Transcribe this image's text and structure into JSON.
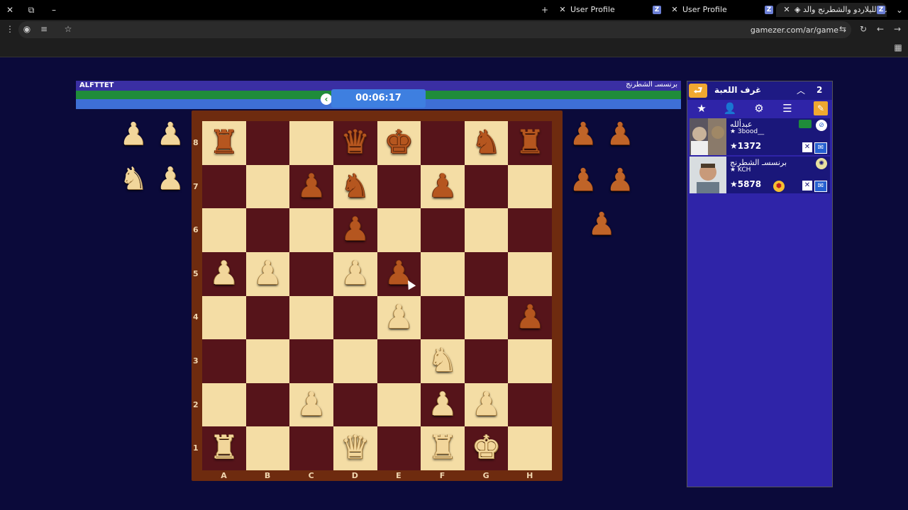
{
  "browser": {
    "tabs": [
      {
        "label": "User Profile"
      },
      {
        "label": "User Profile"
      },
      {
        "label": "العب الليلاردو والشطرنج والد"
      }
    ],
    "url": "gamezer.com/ar/game"
  },
  "game": {
    "player_name": "ALFTTET",
    "room_name": "برنسسـ الشطرنج",
    "timer": "00:06:17",
    "rank_labels": [
      "8",
      "7",
      "6",
      "5",
      "4",
      "3",
      "2",
      "1"
    ],
    "file_labels": [
      "A",
      "B",
      "C",
      "D",
      "E",
      "F",
      "G",
      "H"
    ],
    "board": [
      [
        "bR",
        "",
        "",
        "bQ",
        "bK",
        "",
        "bN",
        "bR"
      ],
      [
        "",
        "",
        "bP",
        "bN",
        "",
        "bP",
        "",
        ""
      ],
      [
        "",
        "",
        "",
        "bP",
        "",
        "",
        "",
        ""
      ],
      [
        "wP",
        "wP",
        "",
        "wP",
        "bP",
        "",
        "",
        ""
      ],
      [
        "",
        "",
        "",
        "",
        "wP",
        "",
        "",
        "bP"
      ],
      [
        "",
        "",
        "",
        "",
        "",
        "wN",
        "",
        ""
      ],
      [
        "",
        "",
        "wP",
        "",
        "",
        "wP",
        "wP",
        ""
      ],
      [
        "wR",
        "",
        "",
        "wQ",
        "",
        "wR",
        "wK",
        ""
      ]
    ],
    "captured_left": [
      "wP",
      "wP",
      "wN",
      "wP"
    ],
    "captured_right": [
      "bP",
      "bP",
      "bP",
      "bP",
      "bP"
    ]
  },
  "panel": {
    "title": "غرف اللعبة",
    "count": "2",
    "players": [
      {
        "name": "عبدألله",
        "handle": "★ 3bood__",
        "score": "★1372"
      },
      {
        "name": "برنسسـ الشطرنج",
        "handle": "★ KCH",
        "score": "★5878"
      }
    ]
  },
  "colors": {
    "board_light": "#f4dda5",
    "board_dark": "#56141a",
    "panel_bg": "#2f24a8",
    "page_bg": "#0b0a3a"
  }
}
